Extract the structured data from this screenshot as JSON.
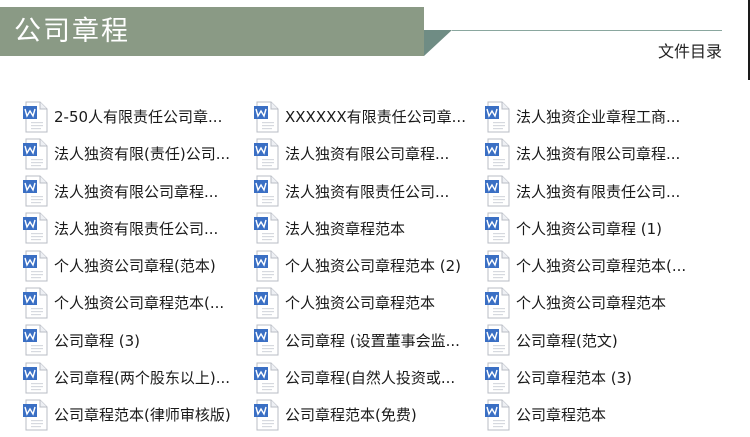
{
  "header": {
    "title": "公司章程",
    "catalog_label": "文件目录"
  },
  "files": [
    "2-50人有限责任公司章...",
    "XXXXXX有限责任公司章...",
    "法人独资企业章程工商...",
    "法人独资有限(责任)公司...",
    "法人独资有限公司章程...",
    "法人独资有限公司章程...",
    "法人独资有限公司章程...",
    "法人独资有限责任公司...",
    "法人独资有限责任公司...",
    "法人独资有限责任公司...",
    "法人独资章程范本",
    "个人独资公司章程 (1)",
    "个人独资公司章程(范本)",
    "个人独资公司章程范本 (2)",
    "个人独资公司章程范本(...",
    "个人独资公司章程范本(...",
    "个人独资公司章程范本",
    "个人独资公司章程范本",
    "公司章程 (3)",
    "公司章程 (设置董事会监...",
    "公司章程(范文)",
    "公司章程(两个股东以上)...",
    "公司章程(自然人投资或...",
    "公司章程范本 (3)",
    "公司章程范本(律师审核版)",
    "公司章程范本(免费)",
    "公司章程范本"
  ],
  "icon": "word-document-icon",
  "colors": {
    "header_band": "#8a9a85",
    "header_tail": "#6f8c84",
    "icon_blue": "#3a6fc4"
  }
}
